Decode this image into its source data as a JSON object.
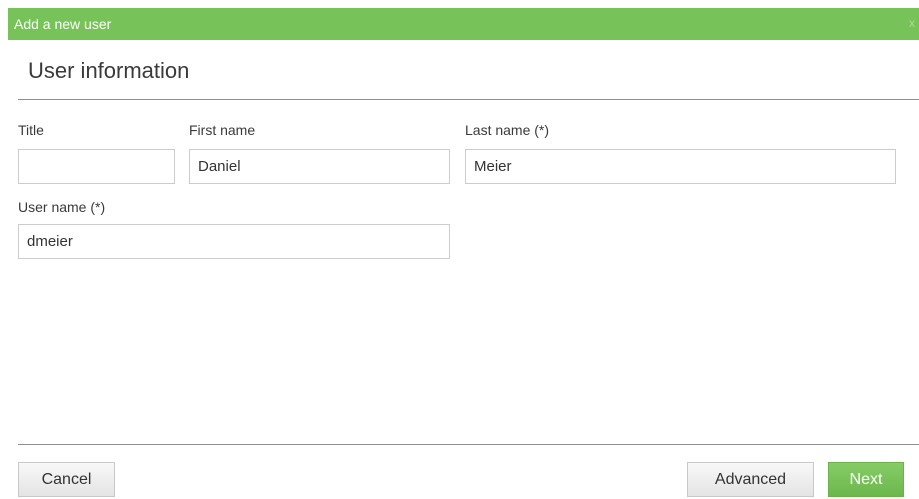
{
  "dialog": {
    "title": "Add a new user",
    "close_glyph": "x"
  },
  "section": {
    "title": "User information"
  },
  "fields": {
    "title": {
      "label": "Title",
      "value": ""
    },
    "first_name": {
      "label": "First name",
      "value": "Daniel"
    },
    "last_name": {
      "label": "Last name (*)",
      "value": "Meier"
    },
    "user_name": {
      "label": "User name (*)",
      "value": "dmeier"
    }
  },
  "buttons": {
    "cancel": "Cancel",
    "advanced": "Advanced",
    "next": "Next"
  },
  "colors": {
    "accent": "#78c25a",
    "primary_button": "#6cb84d"
  },
  "icons": {
    "close": "close-icon"
  }
}
